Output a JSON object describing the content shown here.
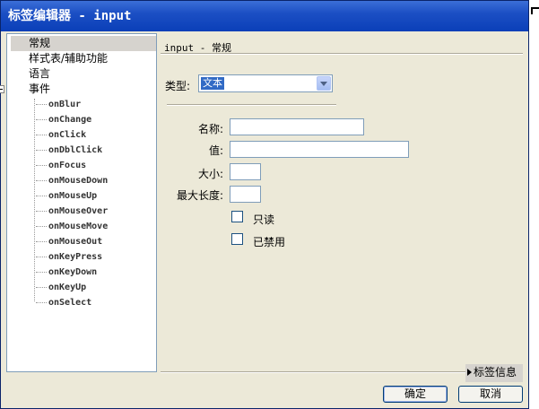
{
  "window": {
    "title": "标签编辑器 - input"
  },
  "tree": {
    "top_items": [
      {
        "label": "常规",
        "selected": true
      },
      {
        "label": "样式表/辅助功能",
        "selected": false
      },
      {
        "label": "语言",
        "selected": false
      },
      {
        "label": "事件",
        "expanded": true
      }
    ],
    "events": [
      "onBlur",
      "onChange",
      "onClick",
      "onDblClick",
      "onFocus",
      "onMouseDown",
      "onMouseUp",
      "onMouseOver",
      "onMouseMove",
      "onMouseOut",
      "onKeyPress",
      "onKeyDown",
      "onKeyUp",
      "onSelect"
    ]
  },
  "panel": {
    "title": "input - 常规",
    "type_label": "类型:",
    "type_value": "文本",
    "fields": {
      "name_label": "名称:",
      "name_value": "",
      "value_label": "值:",
      "value_value": "",
      "size_label": "大小:",
      "size_value": "",
      "maxlength_label": "最大长度:",
      "maxlength_value": ""
    },
    "checkboxes": {
      "readonly_label": "只读",
      "readonly_checked": false,
      "disabled_label": "已禁用",
      "disabled_checked": false
    }
  },
  "footer": {
    "taginfo_label": "标签信息",
    "ok_label": "确定",
    "cancel_label": "取消"
  },
  "colors": {
    "titlebar": "#0a3fb8",
    "selection": "#316ac5",
    "face": "#ece9d8"
  }
}
